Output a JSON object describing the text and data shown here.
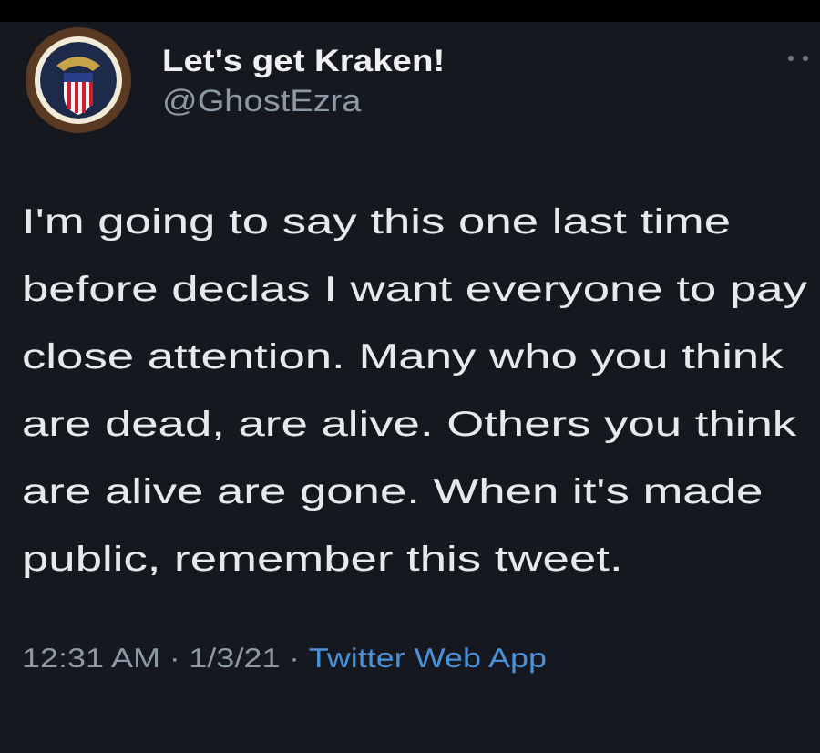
{
  "author": {
    "name": "Let's get Kraken!",
    "handle": "@GhostEzra"
  },
  "tweet": {
    "text": "I'm going to say this one last time before declas I want everyone to pay close attention. Many who you think are dead, are alive. Others you think are alive are gone. When it's made public, remember this tweet."
  },
  "meta": {
    "time": "12:31 AM",
    "separator_1": "·",
    "date": "1/3/21",
    "separator_2": "·",
    "source": "Twitter Web App"
  }
}
